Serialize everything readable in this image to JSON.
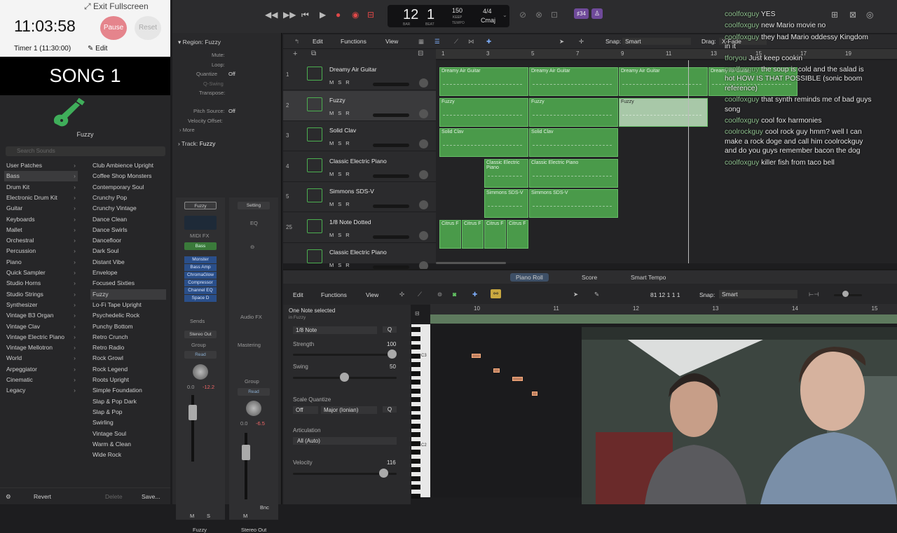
{
  "timer": {
    "exit_label": "Exit Fullscreen",
    "time": "11:03:58",
    "pause_label": "Pause",
    "reset_label": "Reset",
    "timer_label": "Timer 1 (11:30:00)",
    "edit_label": "Edit"
  },
  "song_title": "SONG 1",
  "library": {
    "preset_name": "Fuzzy",
    "search_placeholder": "Search Sounds",
    "categories": [
      {
        "label": "User Patches",
        "sel": false
      },
      {
        "label": "Bass",
        "sel": true
      },
      {
        "label": "Drum Kit",
        "sel": false
      },
      {
        "label": "Electronic Drum Kit",
        "sel": false
      },
      {
        "label": "Guitar",
        "sel": false
      },
      {
        "label": "Keyboards",
        "sel": false
      },
      {
        "label": "Mallet",
        "sel": false
      },
      {
        "label": "Orchestral",
        "sel": false
      },
      {
        "label": "Percussion",
        "sel": false
      },
      {
        "label": "Piano",
        "sel": false
      },
      {
        "label": "Quick Sampler",
        "sel": false
      },
      {
        "label": "Studio Horns",
        "sel": false
      },
      {
        "label": "Studio Strings",
        "sel": false
      },
      {
        "label": "Synthesizer",
        "sel": false
      },
      {
        "label": "Vintage B3 Organ",
        "sel": false
      },
      {
        "label": "Vintage Clav",
        "sel": false
      },
      {
        "label": "Vintage Electric Piano",
        "sel": false
      },
      {
        "label": "Vintage Mellotron",
        "sel": false
      },
      {
        "label": "World",
        "sel": false
      },
      {
        "label": "Arpeggiator",
        "sel": false
      },
      {
        "label": "Cinematic",
        "sel": false
      },
      {
        "label": "Legacy",
        "sel": false
      }
    ],
    "patches": [
      {
        "label": "Club Ambience Upright",
        "sel": false
      },
      {
        "label": "Coffee Shop Monsters",
        "sel": false
      },
      {
        "label": "Contemporary Soul",
        "sel": false
      },
      {
        "label": "Crunchy Pop",
        "sel": false
      },
      {
        "label": "Crunchy Vintage",
        "sel": false
      },
      {
        "label": "Dance Clean",
        "sel": false
      },
      {
        "label": "Dance Swirls",
        "sel": false
      },
      {
        "label": "Dancefloor",
        "sel": false
      },
      {
        "label": "Dark Soul",
        "sel": false
      },
      {
        "label": "Distant Vibe",
        "sel": false
      },
      {
        "label": "Envelope",
        "sel": false
      },
      {
        "label": "Focused Sixties",
        "sel": false
      },
      {
        "label": "Fuzzy",
        "sel": true
      },
      {
        "label": "Lo-Fi Tape Upright",
        "sel": false
      },
      {
        "label": "Psychedelic Rock",
        "sel": false
      },
      {
        "label": "Punchy Bottom",
        "sel": false
      },
      {
        "label": "Retro Crunch",
        "sel": false
      },
      {
        "label": "Retro Radio",
        "sel": false
      },
      {
        "label": "Rock Growl",
        "sel": false
      },
      {
        "label": "Rock Legend",
        "sel": false
      },
      {
        "label": "Roots Upright",
        "sel": false
      },
      {
        "label": "Simple Foundation",
        "sel": false
      },
      {
        "label": "Slap & Pop Dark",
        "sel": false
      },
      {
        "label": "Slap & Pop",
        "sel": false
      },
      {
        "label": "Swirling",
        "sel": false
      },
      {
        "label": "Vintage Soul",
        "sel": false
      },
      {
        "label": "Warm & Clean",
        "sel": false
      },
      {
        "label": "Wide Rock",
        "sel": false
      }
    ],
    "revert": "Revert",
    "delete": "Delete",
    "save": "Save..."
  },
  "inspector": {
    "region_title": "Region: Fuzzy",
    "mute": "Mute:",
    "loop": "Loop:",
    "quantize": "Quantize",
    "quantize_val": "Off",
    "qswing": "Q-Swing",
    "transpose": "Transpose:",
    "pitch_source": "Pitch Source:",
    "pitch_val": "Off",
    "velocity_offset": "Velocity Offset:",
    "more": "More",
    "track_title": "Track:",
    "track_val": "Fuzzy",
    "strip1": {
      "setting": "Fuzzy",
      "midi_fx": "MIDI FX",
      "inst": "Bass",
      "fx": [
        "Monster",
        "Bass Amp",
        "ChromaGlow",
        "Compressor",
        "Channel EQ",
        "Space D"
      ],
      "sends": "Sends",
      "output": "Stereo Out",
      "group": "Group",
      "read": "Read",
      "val1": "0.0",
      "val2": "-12.2",
      "m": "M",
      "s": "S",
      "name": "Fuzzy"
    },
    "strip2": {
      "setting": "Setting",
      "eq": "EQ",
      "audio_fx": "Audio FX",
      "mastering": "Mastering",
      "group": "Group",
      "read": "Read",
      "val1": "0.0",
      "val2": "-6.5",
      "m": "M",
      "bnc": "Bnc",
      "name": "Stereo Out"
    }
  },
  "transport": {
    "bar": "12",
    "beat": "1",
    "bar_label": "BAR",
    "beat_label": "BEAT",
    "tempo": "150",
    "tempo_label": "KEEP",
    "tempo_label2": "TEMPO",
    "sig": "4/4",
    "key": "Cmaj",
    "badge": "♯34"
  },
  "tracks_toolbar": {
    "edit": "Edit",
    "functions": "Functions",
    "view": "View",
    "snap_label": "Snap:",
    "snap_val": "Smart",
    "drag_label": "Drag:",
    "drag_val": "X-Fade"
  },
  "ruler": [
    "1",
    "3",
    "5",
    "7",
    "9",
    "11",
    "13",
    "15",
    "17",
    "19"
  ],
  "tracks": [
    {
      "num": "1",
      "name": "Dreamy Air Guitar"
    },
    {
      "num": "2",
      "name": "Fuzzy"
    },
    {
      "num": "3",
      "name": "Solid Clav"
    },
    {
      "num": "4",
      "name": "Classic Electric Piano"
    },
    {
      "num": "5",
      "name": "Simmons SDS-V"
    },
    {
      "num": "25",
      "name": "1/8 Note Dotted"
    },
    {
      "num": "",
      "name": "Classic Electric Piano"
    }
  ],
  "regions": {
    "guitar": "Dreamy Air Guitar",
    "fuzzy": "Fuzzy",
    "clav": "Solid Clav",
    "piano": "Classic Electric Piano",
    "simmons": "Simmons SDS-V",
    "citrus": "Citrus F"
  },
  "chat": [
    {
      "user": "coolfoxguy",
      "msg": "YES"
    },
    {
      "user": "coolfoxguy",
      "msg": "new Mario movie no"
    },
    {
      "user": "coolfoxguy",
      "msg": "they had Mario oddessy Kingdom in it"
    },
    {
      "user": "tforyou",
      "msg": "Just keep cookin"
    },
    {
      "user": "coolfoxguy",
      "msg": "the soup is cold and the salad is hot HOW IS THAT POSSIBLE (sonic boom reference)"
    },
    {
      "user": "coolfoxguy",
      "msg": "that synth reminds me of bad guys song"
    },
    {
      "user": "coolfoxguy",
      "msg": "cool fox harmonies"
    },
    {
      "user": "coolrockguy",
      "msg": "cool rock guy hmm? well I can make a rock doge and call him coolrockguy and do you guys remember bacon the dog"
    },
    {
      "user": "coolfoxguy",
      "msg": "killer fish from taco bell"
    }
  ],
  "piano_roll": {
    "tab_piano": "Piano Roll",
    "tab_score": "Score",
    "tab_smart": "Smart Tempo",
    "edit": "Edit",
    "functions": "Functions",
    "view": "View",
    "position": "81 12 1 1 1",
    "snap_label": "Snap:",
    "snap_val": "Smart",
    "selected": "One Note selected",
    "in": "in Fuzzy",
    "quant_val": "1/8 Note",
    "q": "Q",
    "strength": "Strength",
    "strength_val": "100",
    "swing": "Swing",
    "swing_val": "50",
    "scale_quantize": "Scale Quantize",
    "scale_off": "Off",
    "scale_mode": "Major (Ionian)",
    "articulation": "Articulation",
    "articulation_val": "All (Auto)",
    "velocity": "Velocity",
    "velocity_val": "116",
    "ruler": [
      "10",
      "11",
      "12",
      "13",
      "14",
      "15"
    ],
    "c3": "C3",
    "c2": "C2"
  },
  "colors": {
    "region_green": "#4a9a4a",
    "accent_blue": "#2a4f8a",
    "pause_red": "#e5848c"
  }
}
